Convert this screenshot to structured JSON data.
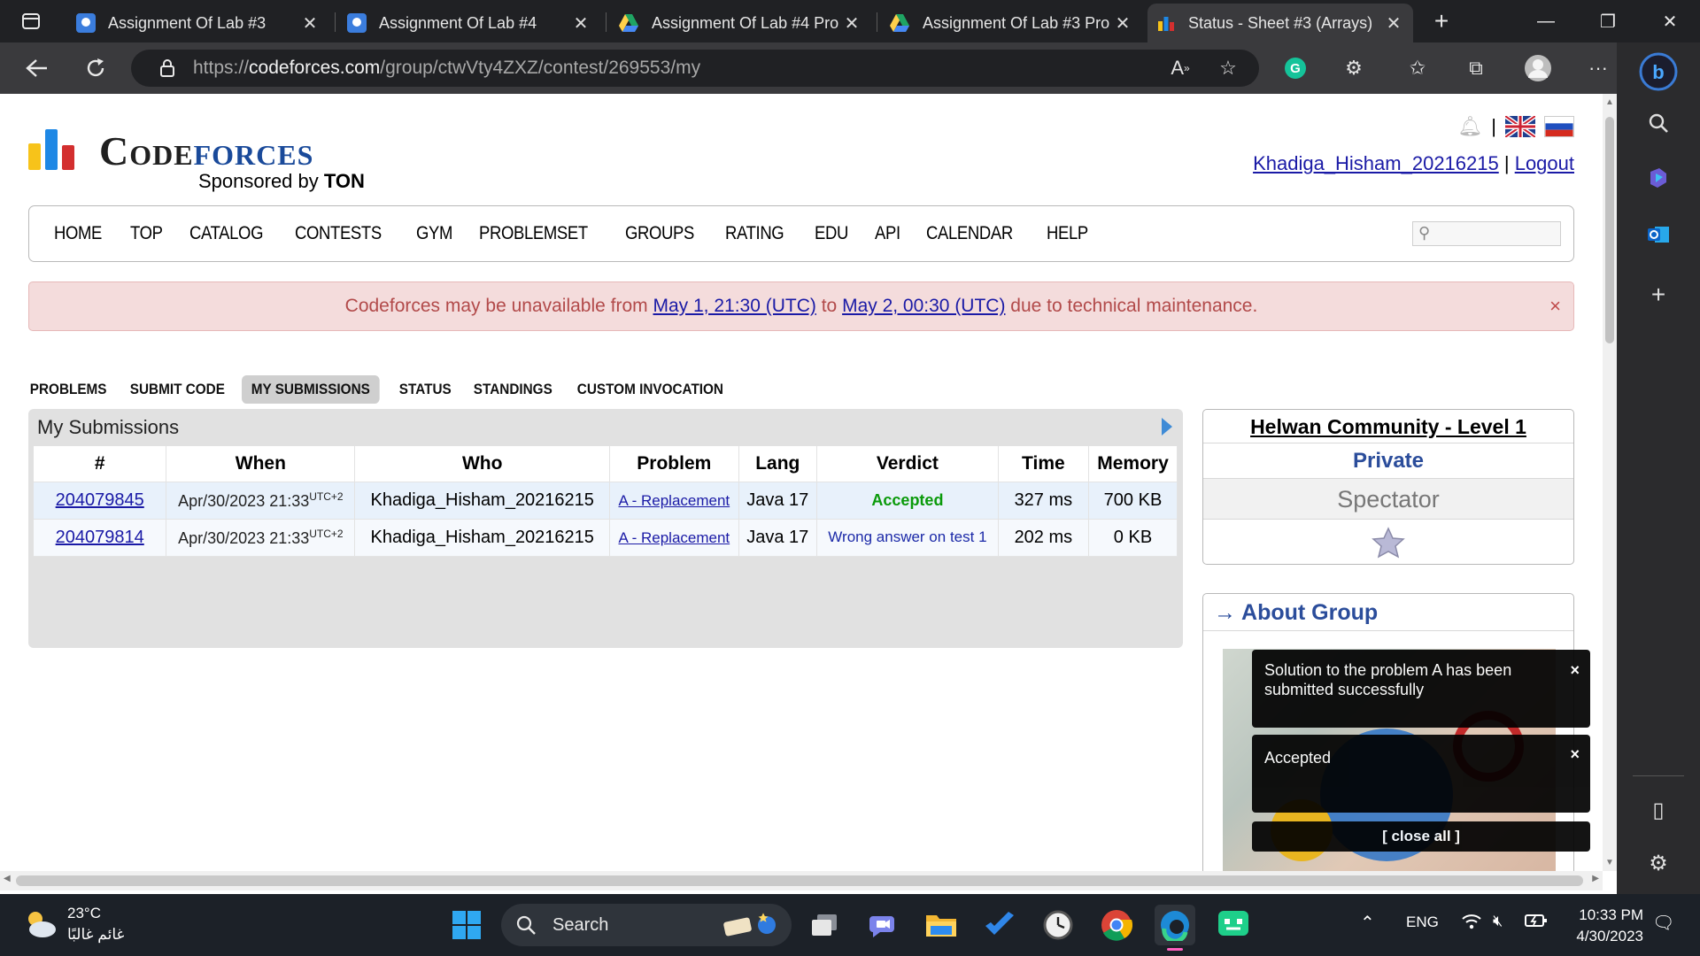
{
  "browser": {
    "tabs": [
      {
        "title": "Assignment Of Lab #3",
        "icon": "doc-icon"
      },
      {
        "title": "Assignment Of Lab #4",
        "icon": "doc-icon"
      },
      {
        "title": "Assignment Of Lab #4 Pro",
        "icon": "drive-icon"
      },
      {
        "title": "Assignment Of Lab #3 Pro",
        "icon": "drive-icon"
      },
      {
        "title": "Status - Sheet #3 (Arrays)",
        "icon": "codeforces-icon"
      }
    ],
    "url_prefix": "https://",
    "url_host": "codeforces.com",
    "url_path": "/group/ctwVty4ZXZ/contest/269553/my"
  },
  "header": {
    "logo_part1": "Code",
    "logo_part2": "forces",
    "sponsor_prefix": "Sponsored by",
    "sponsor_name": "TON",
    "username": "Khadiga_Hisham_20216215",
    "separator": "|",
    "logout": "Logout"
  },
  "menu": [
    "HOME",
    "TOP",
    "CATALOG",
    "CONTESTS",
    "GYM",
    "PROBLEMSET",
    "GROUPS",
    "RATING",
    "EDU",
    "API",
    "CALENDAR",
    "HELP"
  ],
  "alert": {
    "text_before": "Codeforces may be unavailable from ",
    "link1": "May 1, 21:30 (UTC)",
    "text_mid": " to ",
    "link2": "May 2, 00:30 (UTC)",
    "text_after": " due to technical maintenance.",
    "close": "×"
  },
  "subnav": [
    "PROBLEMS",
    "SUBMIT CODE",
    "MY SUBMISSIONS",
    "STATUS",
    "STANDINGS",
    "CUSTOM INVOCATION"
  ],
  "submissions": {
    "title": "My Submissions",
    "headers": [
      "#",
      "When",
      "Who",
      "Problem",
      "Lang",
      "Verdict",
      "Time",
      "Memory"
    ],
    "rows": [
      {
        "id": "204079845",
        "when": "Apr/30/2023 21:33",
        "tz": "UTC+2",
        "who": "Khadiga_Hisham_20216215",
        "problem": "A - Replacement",
        "lang": "Java 17",
        "verdict": "Accepted",
        "time": "327 ms",
        "memory": "700 KB"
      },
      {
        "id": "204079814",
        "when": "Apr/30/2023 21:33",
        "tz": "UTC+2",
        "who": "Khadiga_Hisham_20216215",
        "problem": "A - Replacement",
        "lang": "Java 17",
        "verdict": "Wrong answer on test 1",
        "time": "202 ms",
        "memory": "0 KB"
      }
    ]
  },
  "group_box": {
    "name": "Helwan Community - Level 1",
    "privacy": "Private",
    "role": "Spectator"
  },
  "about": {
    "title": "→ About Group"
  },
  "notifications": [
    {
      "text": "Solution to the problem A has been submitted successfully",
      "close": "×"
    },
    {
      "text": "Accepted",
      "close": "×"
    }
  ],
  "close_all": "[ close all ]",
  "taskbar": {
    "temperature": "23°C",
    "weather": "غائم غالبًا",
    "search": "Search",
    "lang": "ENG",
    "time": "10:33 PM",
    "date": "4/30/2023"
  }
}
